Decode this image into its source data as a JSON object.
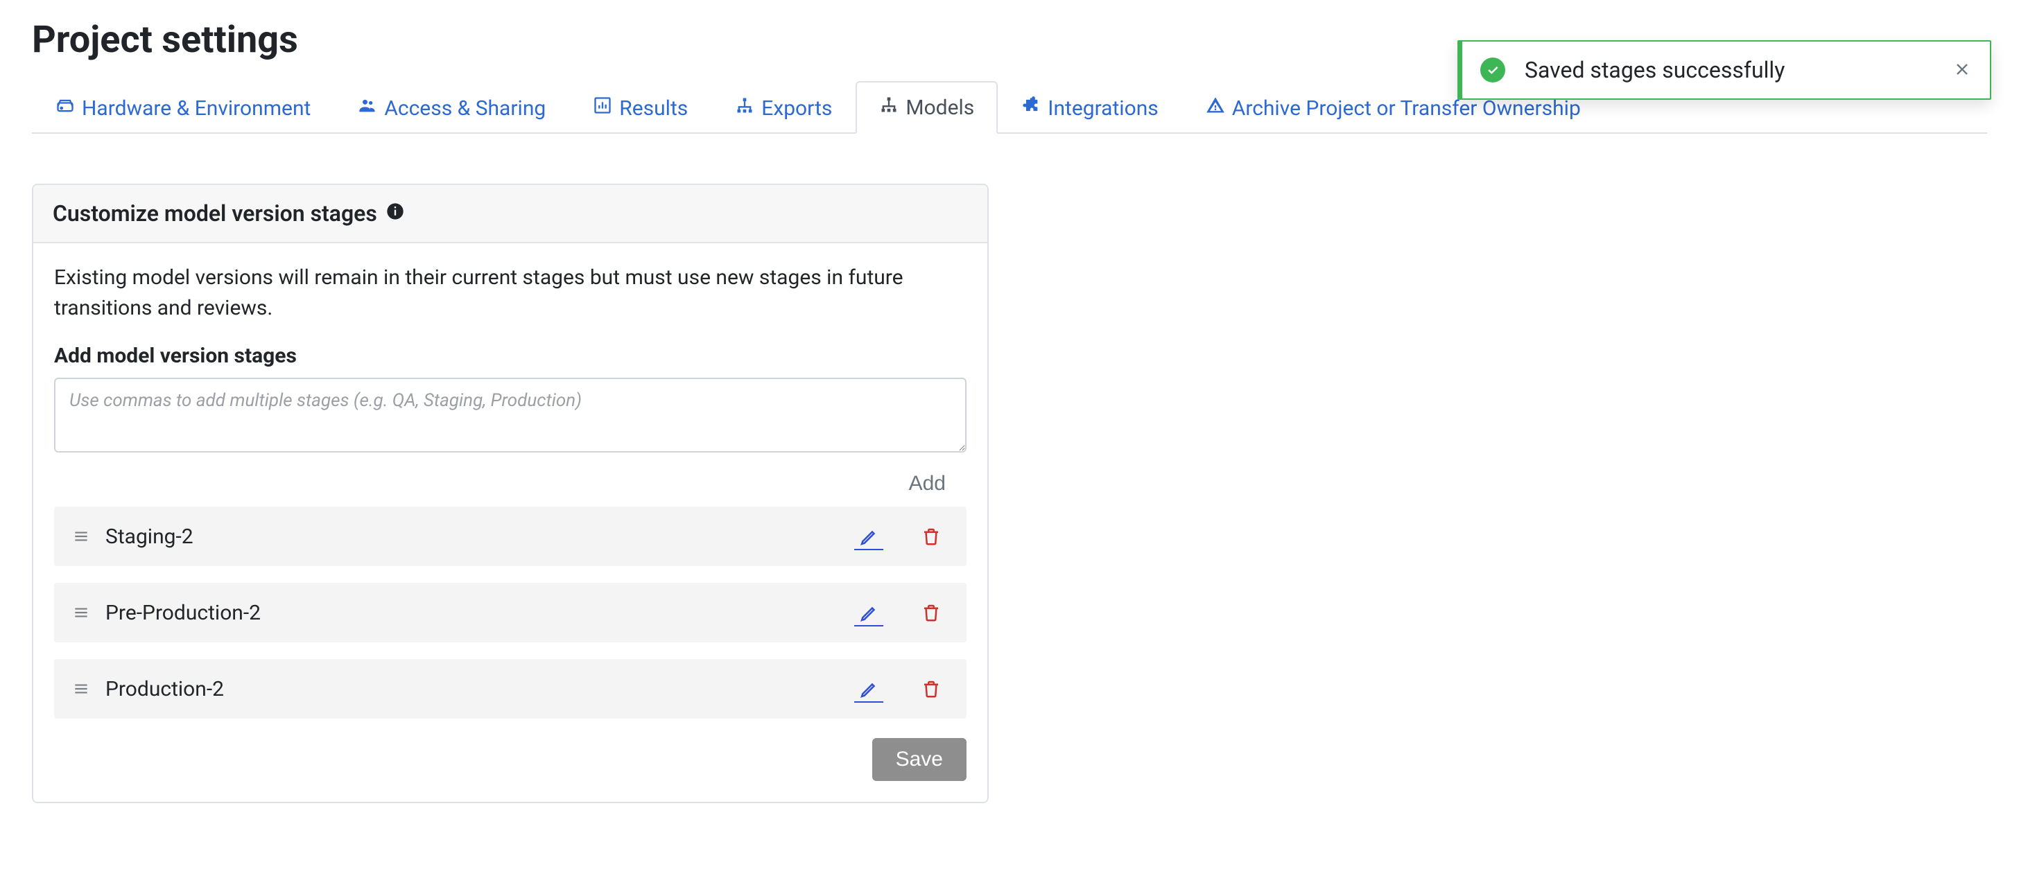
{
  "page": {
    "title": "Project settings"
  },
  "tabs": [
    {
      "id": "hardware",
      "label": "Hardware & Environment",
      "icon": "hdd-icon"
    },
    {
      "id": "access",
      "label": "Access & Sharing",
      "icon": "people-icon"
    },
    {
      "id": "results",
      "label": "Results",
      "icon": "bar-chart-icon"
    },
    {
      "id": "exports",
      "label": "Exports",
      "icon": "sitemap-icon"
    },
    {
      "id": "models",
      "label": "Models",
      "icon": "sitemap-icon",
      "active": true
    },
    {
      "id": "integrations",
      "label": "Integrations",
      "icon": "puzzle-icon"
    },
    {
      "id": "archive",
      "label": "Archive Project or Transfer Ownership",
      "icon": "warning-icon"
    }
  ],
  "panel": {
    "title": "Customize model version stages",
    "description": "Existing model versions will remain in their current stages but must use new stages in future transitions and reviews.",
    "add_label": "Add model version stages",
    "input_placeholder": "Use commas to add multiple stages (e.g. QA, Staging, Production)",
    "input_value": "",
    "add_button": "Add",
    "save_button": "Save"
  },
  "stages": [
    {
      "name": "Staging-2"
    },
    {
      "name": "Pre-Production-2"
    },
    {
      "name": "Production-2"
    }
  ],
  "toast": {
    "message": "Saved stages successfully",
    "status": "success"
  }
}
